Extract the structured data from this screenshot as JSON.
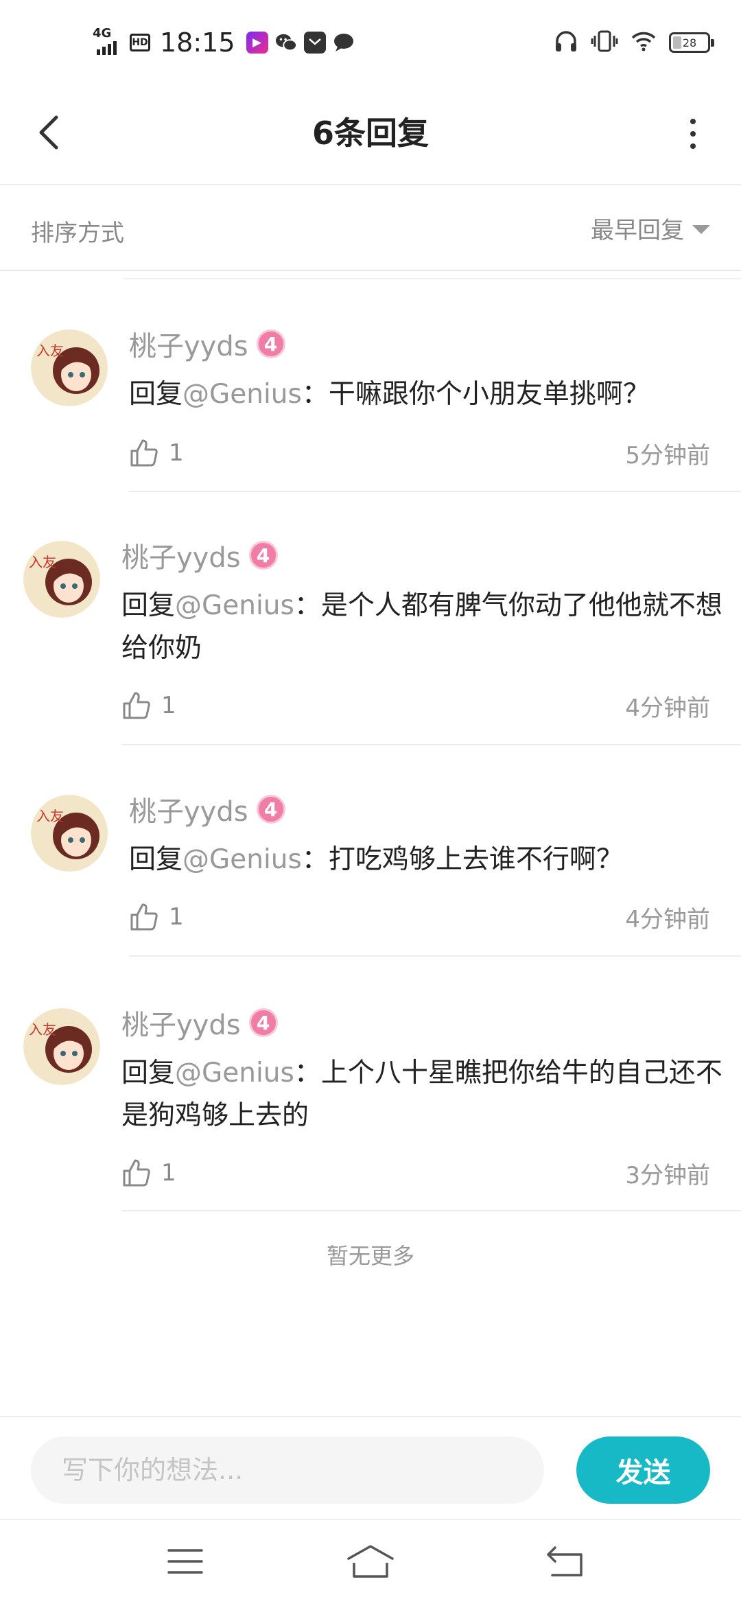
{
  "status_bar": {
    "network": "4G",
    "hd": "HD",
    "time": "18:15",
    "battery": "28",
    "icons": [
      "signal-icon",
      "hd-icon",
      "video-app-icon",
      "wechat-icon",
      "mail-icon",
      "chat-bubble-icon",
      "headphones-icon",
      "vibrate-icon",
      "wifi-icon",
      "battery-icon"
    ]
  },
  "header": {
    "title": "6条回复"
  },
  "sort": {
    "label": "排序方式",
    "selected": "最早回复"
  },
  "comments": [
    {
      "user": "桃子yyds",
      "level": "4",
      "prefix": "回复",
      "mention": "@Genius",
      "text": "：干嘛跟你个小朋友单挑啊？",
      "likes": "1",
      "time": "5分钟前"
    },
    {
      "user": "桃子yyds",
      "level": "4",
      "prefix": "回复",
      "mention": "@Genius",
      "text": "：是个人都有脾气你动了他他就不想给你奶",
      "likes": "1",
      "time": "4分钟前"
    },
    {
      "user": "桃子yyds",
      "level": "4",
      "prefix": "回复",
      "mention": "@Genius",
      "text": "：打吃鸡够上去谁不行啊？",
      "likes": "1",
      "time": "4分钟前"
    },
    {
      "user": "桃子yyds",
      "level": "4",
      "prefix": "回复",
      "mention": "@Genius",
      "text": "：上个八十星瞧把你给牛的自己还不是狗鸡够上去的",
      "likes": "1",
      "time": "3分钟前"
    }
  ],
  "footer_text": "暂无更多",
  "input": {
    "placeholder": "写下你的想法...",
    "send_label": "发送"
  },
  "colors": {
    "accent": "#17b9c6",
    "level_badge": "#f07da5"
  }
}
